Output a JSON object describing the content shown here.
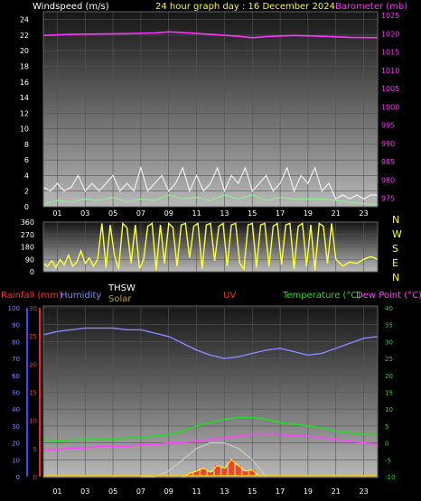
{
  "header": {
    "windspeed_label": "Windspeed (m/s)",
    "title": "24 hour graph day : 16 December 2024",
    "barometer_label": "Barometer (mb)"
  },
  "colors": {
    "background": "#000000",
    "wind_gust": "#f0f0f0",
    "wind_avg": "#90ee90",
    "barometer": "#ff33ff",
    "direction": "#ffff33",
    "rainfall": "#ff3030",
    "humidity": "#8888ff",
    "thsw": "#ffffff",
    "solar": "#c8a040",
    "uv": "#ff3300",
    "temperature": "#22dd22",
    "dewpoint": "#ff44ff",
    "title": "#ffff00"
  },
  "chart_data": [
    {
      "type": "line",
      "name": "wind-and-barometer",
      "hour_ticks": [
        "01",
        "03",
        "05",
        "07",
        "09",
        "11",
        "13",
        "15",
        "17",
        "19",
        "21",
        "23"
      ],
      "y_left": {
        "label": "Windspeed (m/s)",
        "ticks": [
          0,
          2,
          4,
          6,
          8,
          10,
          12,
          14,
          16,
          18,
          20,
          22,
          24
        ],
        "range": [
          0,
          25
        ]
      },
      "y_right": {
        "label": "Barometer (mb)",
        "ticks": [
          975,
          980,
          985,
          990,
          995,
          1000,
          1005,
          1010,
          1015,
          1020,
          1025
        ],
        "range": [
          972.7,
          1026
        ]
      },
      "series": [
        {
          "name": "gust",
          "axis": "left",
          "x": [
            0,
            0.5,
            1,
            1.5,
            2,
            2.5,
            3,
            3.5,
            4,
            4.5,
            5,
            5.5,
            6,
            6.5,
            7,
            7.5,
            8,
            8.5,
            9,
            9.5,
            10,
            10.5,
            11,
            11.5,
            12,
            12.5,
            13,
            13.5,
            14,
            14.5,
            15,
            15.5,
            16,
            16.5,
            17,
            17.5,
            18,
            18.5,
            19,
            19.5,
            20,
            20.5,
            21,
            21.5,
            22,
            22.5,
            23,
            23.5,
            24
          ],
          "y": [
            2.5,
            2,
            3,
            2,
            2.5,
            4,
            2,
            3,
            2,
            3,
            4,
            2,
            3,
            2,
            5,
            2,
            3,
            4,
            2,
            3,
            5,
            2,
            4,
            2,
            3,
            5,
            2,
            4,
            3,
            5,
            2,
            3,
            4,
            2,
            3,
            5,
            2,
            4,
            3,
            5,
            2,
            3,
            1,
            1.5,
            1,
            1.5,
            1,
            1.5,
            1.5
          ]
        },
        {
          "name": "average",
          "axis": "left",
          "x": [
            0,
            1,
            2,
            3,
            4,
            5,
            6,
            7,
            8,
            9,
            10,
            11,
            12,
            13,
            14,
            15,
            16,
            17,
            18,
            19,
            20,
            21,
            22,
            23,
            24
          ],
          "y": [
            0.3,
            0.8,
            0.6,
            1,
            0.8,
            1.2,
            0.6,
            1,
            0.8,
            1.5,
            1,
            1.2,
            0.8,
            1.5,
            1,
            1.5,
            0.8,
            1.2,
            1,
            1,
            1,
            0.8,
            0.6,
            0.4,
            0.3
          ]
        },
        {
          "name": "barometer",
          "axis": "right",
          "x": [
            0,
            2,
            4,
            6,
            8,
            9,
            10,
            12,
            14,
            15,
            16,
            18,
            20,
            22,
            24
          ],
          "y": [
            1019.5,
            1019.8,
            1019.9,
            1020,
            1020.2,
            1020.5,
            1020.3,
            1019.8,
            1019.3,
            1018.9,
            1019.2,
            1019.5,
            1019.3,
            1019,
            1018.9
          ]
        }
      ]
    },
    {
      "type": "line",
      "name": "wind-direction",
      "hour_ticks": [
        "01",
        "03",
        "05",
        "07",
        "09",
        "11",
        "13",
        "15",
        "17",
        "19",
        "21",
        "23"
      ],
      "y_left": {
        "ticks": [
          0,
          90,
          180,
          270,
          360
        ],
        "range": [
          0,
          360
        ]
      },
      "compass_labels": [
        "N",
        "W",
        "S",
        "E",
        "N"
      ],
      "series": [
        {
          "name": "direction",
          "x": [
            0,
            0.3,
            0.6,
            0.9,
            1.2,
            1.5,
            1.8,
            2.1,
            2.4,
            2.7,
            3,
            3.3,
            3.6,
            3.9,
            4.2,
            4.5,
            4.8,
            5.1,
            5.4,
            5.7,
            6,
            6.3,
            6.6,
            6.9,
            7.2,
            7.5,
            7.8,
            8.1,
            8.4,
            8.7,
            9,
            9.3,
            9.6,
            9.9,
            10.2,
            10.5,
            10.8,
            11.1,
            11.4,
            11.7,
            12,
            12.3,
            12.6,
            12.9,
            13.2,
            13.5,
            13.8,
            14.1,
            14.4,
            14.7,
            15,
            15.3,
            15.6,
            15.9,
            16.2,
            16.5,
            16.8,
            17.1,
            17.4,
            17.7,
            18,
            18.3,
            18.6,
            18.9,
            19.2,
            19.5,
            19.8,
            20.1,
            20.4,
            20.7,
            21,
            21.5,
            22,
            22.5,
            23,
            23.5,
            24
          ],
          "y": [
            60,
            40,
            80,
            30,
            90,
            50,
            120,
            40,
            70,
            150,
            60,
            100,
            40,
            90,
            350,
            30,
            340,
            120,
            20,
            350,
            320,
            60,
            340,
            20,
            90,
            330,
            350,
            10,
            340,
            60,
            350,
            320,
            40,
            340,
            350,
            100,
            330,
            350,
            20,
            340,
            350,
            80,
            330,
            350,
            40,
            340,
            350,
            60,
            20,
            340,
            350,
            30,
            340,
            350,
            40,
            330,
            350,
            50,
            340,
            350,
            20,
            330,
            350,
            40,
            340,
            10,
            350,
            330,
            60,
            350,
            90,
            40,
            70,
            60,
            90,
            110,
            90
          ]
        }
      ]
    },
    {
      "type": "line",
      "name": "rain-humidity-temperature",
      "hour_ticks": [
        "01",
        "03",
        "05",
        "07",
        "09",
        "11",
        "13",
        "15",
        "17",
        "19",
        "21",
        "23"
      ],
      "y_left_outer": {
        "label": "Humidity",
        "ticks": [
          0,
          10,
          20,
          30,
          40,
          50,
          60,
          70,
          80,
          90,
          100
        ],
        "range": [
          0,
          100
        ]
      },
      "y_left_inner": {
        "label": "Rainfall (mm)",
        "ticks": [
          0,
          5,
          10,
          15,
          20,
          25,
          30
        ],
        "range": [
          0,
          30
        ]
      },
      "y_right": {
        "label": "Temperature (°C)",
        "ticks": [
          -10,
          -5,
          0,
          5,
          10,
          15,
          20,
          25,
          30,
          35,
          40
        ],
        "range": [
          -10,
          40
        ]
      },
      "header_labels": [
        "Rainfall (mm)",
        "Humidity",
        "THSW",
        "Solar",
        "UV",
        "Temperature (°C)",
        "Dew Point (°C)"
      ],
      "series": [
        {
          "name": "humidity",
          "axis": "left_outer",
          "x": [
            0,
            1,
            2,
            3,
            4,
            5,
            6,
            7,
            8,
            9,
            10,
            11,
            12,
            13,
            14,
            15,
            16,
            17,
            18,
            19,
            20,
            21,
            22,
            23,
            24
          ],
          "y": [
            84,
            86,
            87,
            88,
            88,
            88,
            87,
            87,
            85,
            83,
            79,
            75,
            72,
            70,
            71,
            73,
            75,
            76,
            74,
            72,
            73,
            76,
            79,
            82,
            83
          ]
        },
        {
          "name": "temperature",
          "axis": "right",
          "x": [
            0,
            1,
            2,
            3,
            4,
            5,
            6,
            7,
            8,
            9,
            10,
            11,
            12,
            13,
            14,
            15,
            16,
            17,
            18,
            19,
            20,
            21,
            22,
            23,
            24
          ],
          "y": [
            1,
            0.5,
            0.8,
            1,
            1,
            1,
            1.5,
            1.5,
            2,
            2.5,
            3.5,
            5,
            6,
            7,
            7.5,
            7.5,
            7,
            6,
            5.5,
            5,
            4.5,
            3.5,
            3,
            2.5,
            2.5
          ]
        },
        {
          "name": "dewpoint",
          "axis": "right",
          "x": [
            0,
            1,
            2,
            3,
            4,
            5,
            6,
            7,
            8,
            9,
            10,
            11,
            12,
            13,
            14,
            15,
            16,
            17,
            18,
            19,
            20,
            21,
            22,
            23,
            24
          ],
          "y": [
            -2,
            -2,
            -1.5,
            -1.5,
            -1,
            -1,
            -1,
            -0.5,
            -0.5,
            0,
            0,
            0.5,
            1,
            1.5,
            2,
            2.5,
            2.5,
            2.5,
            2,
            2,
            1.5,
            1,
            0.5,
            0,
            -0.5
          ]
        },
        {
          "name": "solar",
          "axis": "left_inner",
          "x": [
            7,
            8,
            9,
            10,
            11,
            12,
            13,
            14,
            15,
            16
          ],
          "y": [
            0,
            0,
            1,
            3,
            5,
            6,
            6,
            5,
            3,
            0
          ]
        },
        {
          "name": "uv",
          "axis": "left_inner",
          "x": [
            10,
            10.5,
            11,
            11.5,
            12,
            12.5,
            13,
            13.5,
            14,
            14.5,
            15,
            15.5
          ],
          "y": [
            0,
            0.6,
            1,
            1.5,
            0.8,
            2,
            1.5,
            3,
            2,
            1,
            1.2,
            0
          ]
        }
      ]
    }
  ]
}
